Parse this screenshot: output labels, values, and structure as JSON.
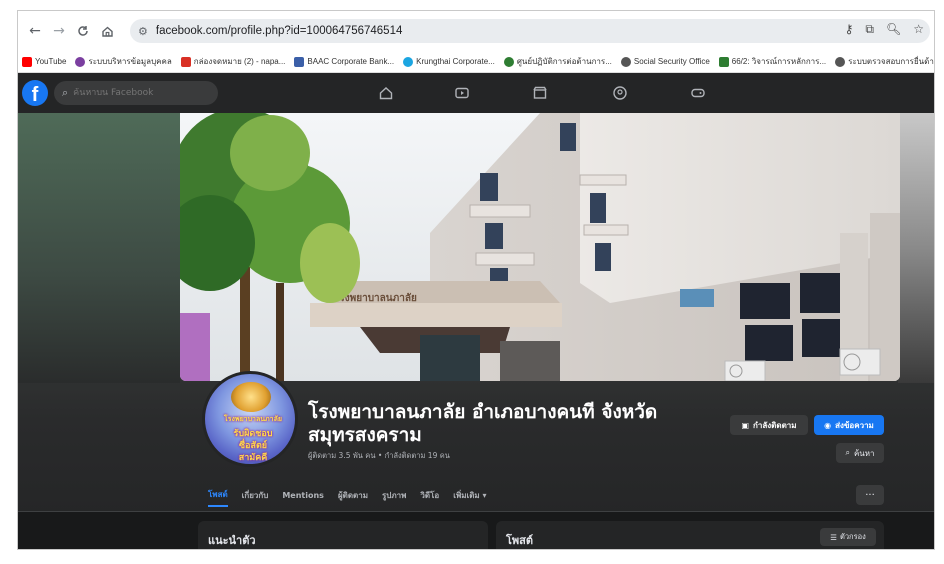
{
  "browser": {
    "url": "facebook.com/profile.php?id=100064756746514"
  },
  "bookmarks": [
    {
      "label": "YouTube",
      "color": "#ff0000"
    },
    {
      "label": "ระบบบริหารข้อมูลบุคคล",
      "color": "#7b3fa0"
    },
    {
      "label": "กล่องจดหมาย (2) - napa...",
      "color": "#d93025"
    },
    {
      "label": "BAAC Corporate Bank...",
      "color": "#3b5fa8"
    },
    {
      "label": "Krungthai Corporate...",
      "color": "#1ba5e1"
    },
    {
      "label": "ศูนย์ปฏิบัติการต่อต้านการ...",
      "color": "#2e7d32"
    },
    {
      "label": "Social Security Office",
      "color": "#555555"
    },
    {
      "label": "66/2: วิจารณ์การหลักการ...",
      "color": "#2e7d32"
    },
    {
      "label": "ระบบตรวจสอบการยื่นด้าน...",
      "color": "#555555"
    }
  ],
  "facebook": {
    "logo": "f",
    "search_placeholder": "ค้นหาบน Facebook"
  },
  "cover": {
    "sign_text": "โรงพยาบาลนภาลัย"
  },
  "avatar": {
    "lines": [
      "โรงพยาบาลนภาลัย",
      "รับผิดชอบ",
      "ซื่อสัตย์",
      "สามัคคี"
    ]
  },
  "profile": {
    "name": "โรงพยาบาลนภาลัย อำเภอบางคนที จังหวัดสมุทรสงคราม",
    "meta": "ผู้ติดตาม 3.5 พัน คน • กำลังติดตาม 19 คน",
    "following_label": "กำลังติดตาม",
    "message_label": "ส่งข้อความ",
    "search_label": "ค้นหา",
    "more_label": "···"
  },
  "tabs": [
    {
      "label": "โพสต์",
      "active": true
    },
    {
      "label": "เกี่ยวกับ",
      "active": false
    },
    {
      "label": "Mentions",
      "active": false
    },
    {
      "label": "ผู้ติดตาม",
      "active": false
    },
    {
      "label": "รูปภาพ",
      "active": false
    },
    {
      "label": "วิดีโอ",
      "active": false
    },
    {
      "label": "เพิ่มเติม ▾",
      "active": false
    }
  ],
  "panels": {
    "intro_title": "แนะนำตัว",
    "posts_title": "โพสต์",
    "filter_label": "ตัวกรอง"
  },
  "colors": {
    "fb_blue": "#1877f2",
    "bar": "#242526",
    "active_tab": "#2d88ff"
  }
}
